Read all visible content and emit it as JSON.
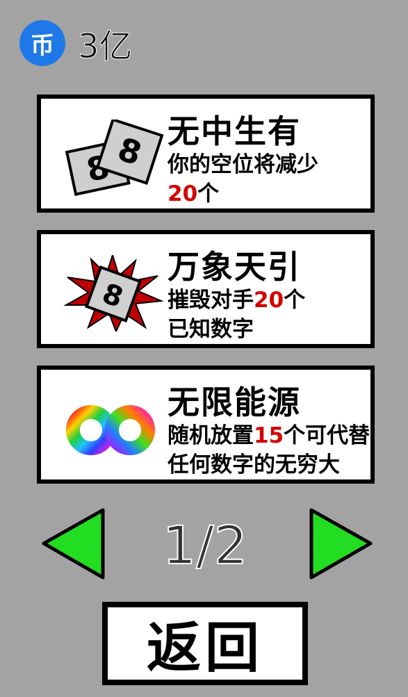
{
  "coins": {
    "icon_glyph": "币",
    "amount": "3亿",
    "icon_color": "#1f78e8"
  },
  "cards": [
    {
      "icon": "dice-pair-icon",
      "title": "无中生有",
      "desc_line1": "你的空位将减少",
      "desc_line2_num": "20",
      "desc_line2_text": "个"
    },
    {
      "icon": "spiked-burst-dice-icon",
      "title": "万象天引",
      "desc_line1_text": "摧毁对手",
      "desc_line1_num": "20",
      "desc_line1_suffix": "个",
      "desc_line2": "已知数字"
    },
    {
      "icon": "rainbow-infinity-icon",
      "title": "无限能源",
      "desc_line1_text": "随机放置",
      "desc_line1_num": "15",
      "desc_line1_suffix": "个可代替",
      "desc_line2": "任何数字的无穷大"
    }
  ],
  "pager": {
    "page": "1/2",
    "arrow_color": "#22dd22"
  },
  "back_label": "返回",
  "highlight_color": "#d60000",
  "dice_digit": "8"
}
